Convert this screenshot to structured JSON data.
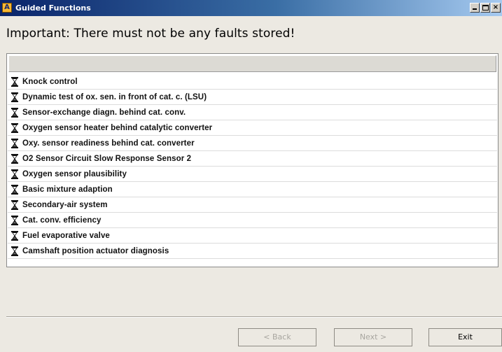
{
  "window": {
    "title": "Guided Functions",
    "app_icon_letter": "A",
    "minimize_glyph": "_",
    "restore_glyph": "□",
    "close_glyph": "×"
  },
  "headline": "Important: There must not be any faults stored!",
  "list": {
    "item_icon": "hourglass-icon",
    "items": [
      "Knock control",
      "Dynamic test of ox. sen. in front of cat. c. (LSU)",
      "Sensor-exchange diagn. behind cat. conv.",
      "Oxygen sensor heater behind catalytic converter",
      "Oxy. sensor readiness behind cat. converter",
      "O2 Sensor Circuit Slow Response Sensor 2",
      "Oxygen sensor plausibility",
      "Basic mixture adaption",
      "Secondary-air system",
      "Cat. conv. efficiency",
      "Fuel evaporative valve",
      "Camshaft position actuator diagnosis"
    ]
  },
  "buttons": {
    "back": "< Back",
    "next": "Next >",
    "exit": "Exit"
  }
}
